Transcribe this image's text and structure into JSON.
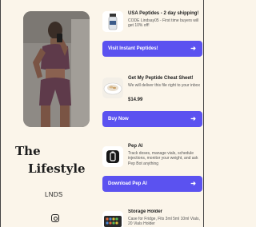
{
  "profile": {
    "title_line1": "The",
    "title_line2": "Lifestyle",
    "handle": "LNDS",
    "social_icon": "instagram-icon"
  },
  "cards": [
    {
      "title": "USA Peptides - 2 day shipping!",
      "desc": "CODE Lindsay05 - First time buyers will get 10% off!",
      "button": "Visit Instant Peptides!",
      "thumb_icon": "vial-icon"
    },
    {
      "title": "Get My Peptide Cheat Sheet!",
      "desc": "We will deliver this file right to your inbox",
      "price": "$14.99",
      "button": "Buy Now",
      "thumb_icon": "bowl-icon"
    },
    {
      "title": "Pep AI",
      "desc": "Track doses, manage vials, schedule injections, monitor your weight, and ask Pep Bot anything",
      "button": "Download Pep AI",
      "thumb_icon": "pep-ai-logo-icon"
    },
    {
      "title": "Storage Holder",
      "desc": "Case for Fridge, Fits 3ml 5ml 10ml Vials, 20 Vials Holder",
      "thumb_icon": "storage-case-icon"
    }
  ],
  "colors": {
    "background": "#fbf5ea",
    "button": "#5b52f0",
    "button_text": "#ffffff"
  }
}
